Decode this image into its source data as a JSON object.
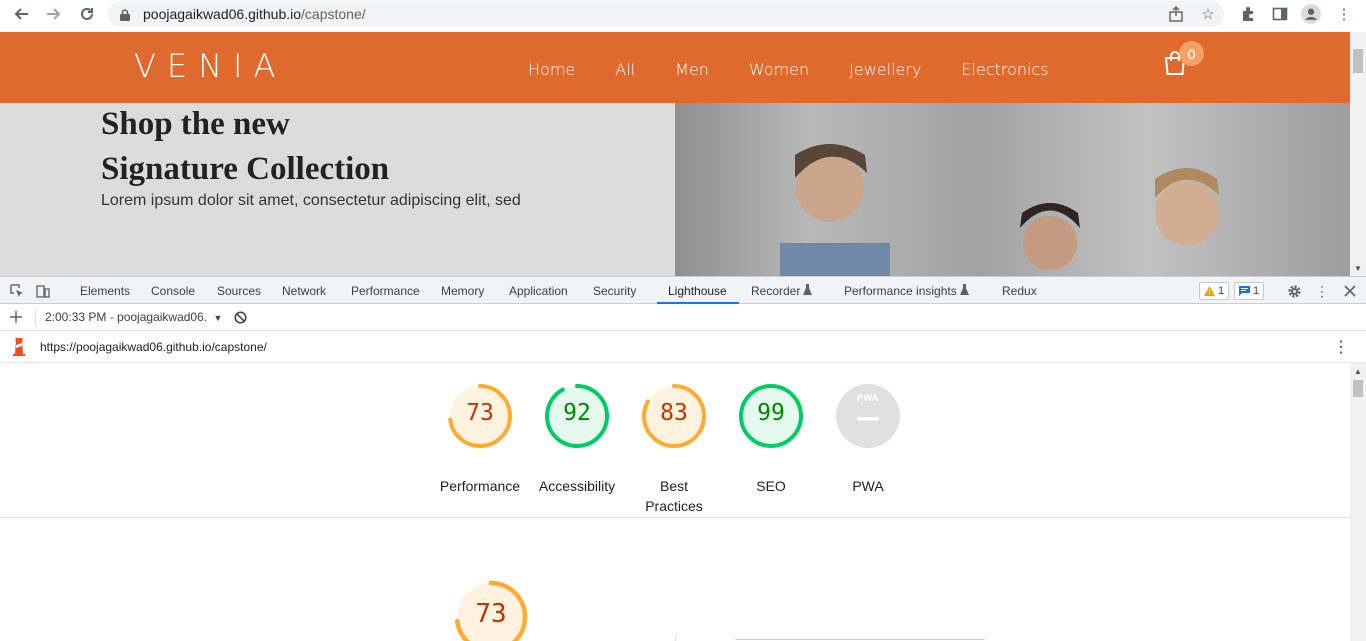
{
  "browser": {
    "url_host": "poojagaikwad06.github.io",
    "url_path": "/capstone/"
  },
  "site": {
    "logo": "VENIA",
    "nav": [
      "Home",
      "All",
      "Men",
      "Women",
      "Jewellery",
      "Electronics"
    ],
    "cart_count": "0",
    "hero_title_line1": "Shop the new",
    "hero_title_line2": "Signature Collection",
    "hero_text": "Lorem ipsum dolor sit amet, consectetur adipiscing elit, sed"
  },
  "devtools": {
    "tabs": [
      "Elements",
      "Console",
      "Sources",
      "Network",
      "Performance",
      "Memory",
      "Application",
      "Security",
      "Lighthouse",
      "Recorder",
      "Performance insights",
      "Redux"
    ],
    "active_tab": "Lighthouse",
    "warnings_count": "1",
    "messages_count": "1",
    "report_selector": "2:00:33 PM - poojagaikwad06.",
    "report_url": "https://poojagaikwad06.github.io/capstone/"
  },
  "lighthouse": {
    "scores": [
      {
        "label": "Performance",
        "value": "73",
        "score": 73,
        "status": "average"
      },
      {
        "label": "Accessibility",
        "value": "92",
        "score": 92,
        "status": "pass"
      },
      {
        "label_line1": "Best",
        "label_line2": "Practices",
        "value": "83",
        "score": 83,
        "status": "average"
      },
      {
        "label": "SEO",
        "value": "99",
        "score": 99,
        "status": "pass"
      },
      {
        "label": "PWA",
        "value": "PWA",
        "status": "na"
      }
    ],
    "performance_detail_score": "73",
    "colors": {
      "average": "#fa3",
      "average_text": "#c33300",
      "pass": "#0c6",
      "pass_text": "#008800",
      "na": "#e0e0e0"
    }
  }
}
